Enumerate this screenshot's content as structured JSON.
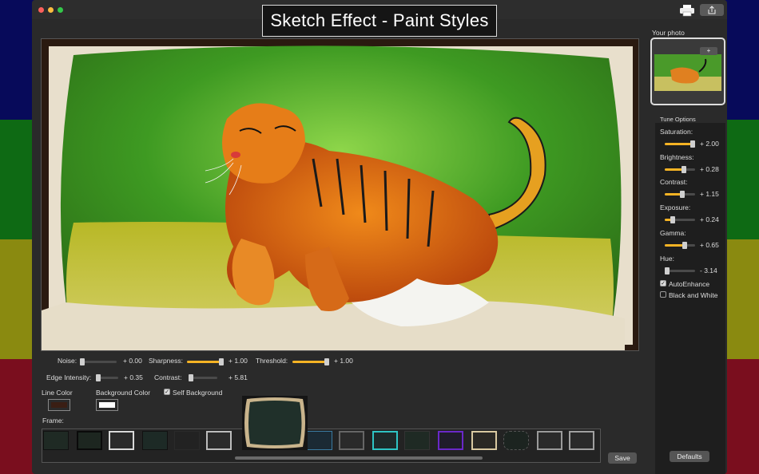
{
  "window": {
    "title_banner": "Sketch Effect - Paint Styles"
  },
  "toolbar": {
    "print_icon": "printer-icon",
    "share_icon": "share-icon"
  },
  "bottom_sliders": {
    "noise": {
      "label": "Noise:",
      "value": "+ 0.00",
      "level": 0.0
    },
    "sharpness": {
      "label": "Sharpness:",
      "value": "+ 1.00",
      "level": 1.0
    },
    "threshold": {
      "label": "Threshold:",
      "value": "+ 1.00",
      "level": 1.0
    },
    "edge_intensity": {
      "label": "Edge Intensity:",
      "value": "+ 0.35",
      "level": 0.12
    },
    "contrast": {
      "label": "Contrast:",
      "value": "+ 5.81",
      "level": 0.0
    }
  },
  "colors": {
    "line_color_label": "Line Color",
    "line_color_value": "#3a1e14",
    "background_color_label": "Background Color",
    "background_color_value": "#ffffff",
    "self_background_label": "Self Background",
    "self_background_checked": true
  },
  "frame": {
    "label": "Frame:"
  },
  "save_label": "Save",
  "sidebar": {
    "your_photo_label": "Your photo",
    "add_label": "+",
    "tune_options_label": "Tune Options",
    "sliders": [
      {
        "label": "Saturation:",
        "value": "+ 2.00",
        "level": 1.0
      },
      {
        "label": "Brightness:",
        "value": "+ 0.28",
        "level": 0.64
      },
      {
        "label": "Contrast:",
        "value": "+ 1.15",
        "level": 0.58
      },
      {
        "label": "Exposure:",
        "value": "+ 0.24",
        "level": 0.25
      },
      {
        "label": "Gamma:",
        "value": "+ 0.65",
        "level": 0.65
      },
      {
        "label": "Hue:",
        "value": "- 3.14",
        "level": 0.0
      }
    ],
    "auto_enhance_label": "AutoEnhance",
    "auto_enhance_checked": true,
    "black_white_label": "Black and White",
    "black_white_checked": false,
    "defaults_label": "Defaults"
  },
  "accent_color": "#f5b324"
}
